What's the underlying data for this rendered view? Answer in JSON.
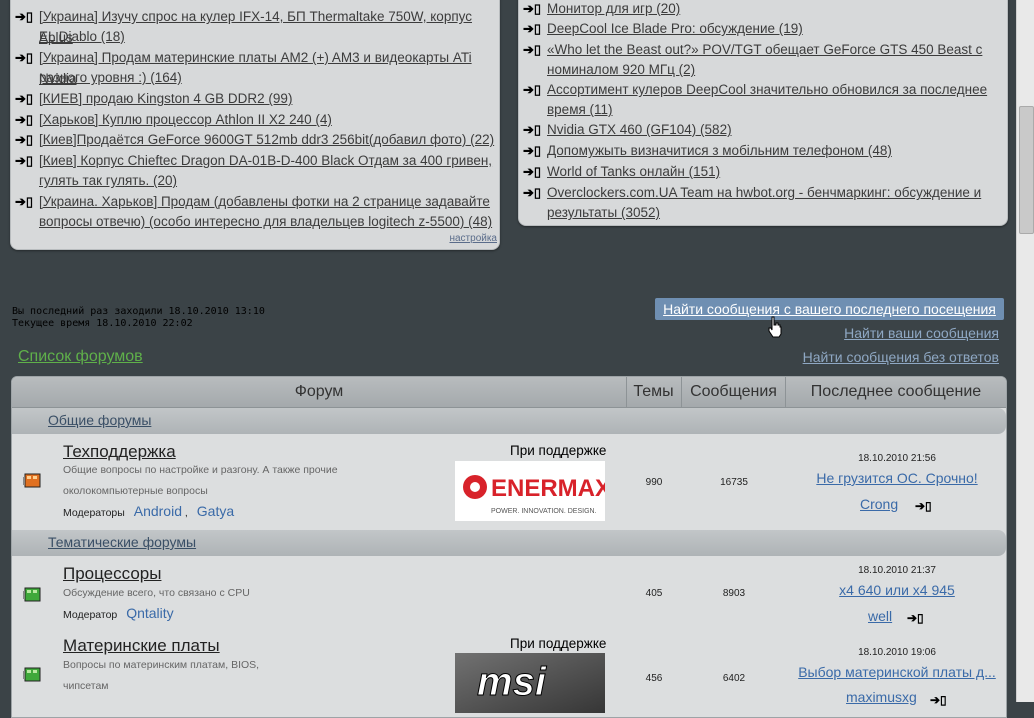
{
  "left_topics": [
    {
      "label": "[Украина] Изучу спрос на кулер IFX-14, БП Thermaltake 750W, корпус Aplus"
    },
    {
      "label": "EL Diablo (18)"
    },
    {
      "label": "[Украина] Продам материнские платы AM2 (+) AM3 и видеокарты ATi Nvidia"
    },
    {
      "label": "разного уровня :) (164)"
    },
    {
      "label": "[КИЕВ] продаю Kingston 4 GB DDR2 (99)"
    },
    {
      "label": "[Харьков] Куплю процессор Athlon II X2 240 (4)"
    },
    {
      "label": "[Киев]Продаётся GeForce 9600GT 512mb ddr3 256bit(добавил фото) (22)"
    },
    {
      "label": "[Киев] Корпус Chieftec Dragon DA-01B-D-400 Black Отдам за 400 гривен,"
    },
    {
      "label": "гулять так гулять. (20)"
    },
    {
      "label": "[Украина. Харьков] Продам (добавлены фотки на 2 странице задавайте"
    },
    {
      "label": "вопросы отвечю) (особо интересно для владельцев logitech z-5500) (48)"
    }
  ],
  "left_settings": "настройка",
  "right_topics": [
    {
      "label": "Монитор для игр (20)"
    },
    {
      "label": "DeepCool Ice Blade Pro: обсуждение (19)"
    },
    {
      "label": "«Who let the Beast out?» POV/TGT обещает GeForce GTS 450 Beast с"
    },
    {
      "label": "номиналом 920 МГц (2)"
    },
    {
      "label": "Ассортимент кулеров DeepCool значительно обновился за последнее"
    },
    {
      "label": "время (11)"
    },
    {
      "label": "Nvidia GTX 460 (GF104) (582)"
    },
    {
      "label": "Допомужыть визначитися з мобільним телефоном (48)"
    },
    {
      "label": "World of Tanks онлайн (151)"
    },
    {
      "label": "Overclockers.com.UA Team на hwbot.org - бенчмаркинг: обсуждение и"
    },
    {
      "label": "результаты (3052)"
    }
  ],
  "visit": {
    "last": "Вы последний раз заходили 18.10.2010 13:10",
    "current": "Текущее время 18.10.2010 22:02"
  },
  "links": {
    "new_posts": "Найти сообщения с вашего последнего посещения",
    "your_posts": "Найти ваши сообщения",
    "unanswered": "Найти сообщения без ответов",
    "forum_index": "Список форумов"
  },
  "table": {
    "headers": [
      "Форум",
      "Темы",
      "Сообщения",
      "Последнее сообщение"
    ],
    "categories": [
      "Общие форумы",
      "Тематические форумы"
    ],
    "moderators_label": "Модераторы",
    "moderator_label": "Модератор",
    "sponsor_label": "При поддержке",
    "forums": [
      {
        "title": "Техподдержка",
        "desc": "Общие вопросы по настройке и разгону. А также прочие околокомпьютерные вопросы",
        "mods": [
          "Android",
          "Gatya"
        ],
        "topics": "990",
        "posts": "16735",
        "last_date": "18.10.2010 21:56",
        "last_topic": "Не грузится ОС. Срочно!",
        "last_author": "Crong",
        "sponsor": "ENERMAX"
      },
      {
        "title": "Процессоры",
        "desc": "Обсуждение всего, что связано с CPU",
        "mods": [
          "Qntality"
        ],
        "topics": "405",
        "posts": "8903",
        "last_date": "18.10.2010 21:37",
        "last_topic": "x4 640 или x4 945",
        "last_author": "well"
      },
      {
        "title": "Материнские платы",
        "desc": "Вопросы по материнским платам, BIOS, чипсетам",
        "topics": "456",
        "posts": "6402",
        "last_date": "18.10.2010 19:06",
        "last_topic": "Выбор материнской платы д...",
        "last_author": "maximusxg",
        "sponsor": "msi"
      }
    ]
  },
  "colors": {
    "accent": "#6f8fb2",
    "forum_index": "#5fb04a",
    "background": "#3b4347"
  }
}
